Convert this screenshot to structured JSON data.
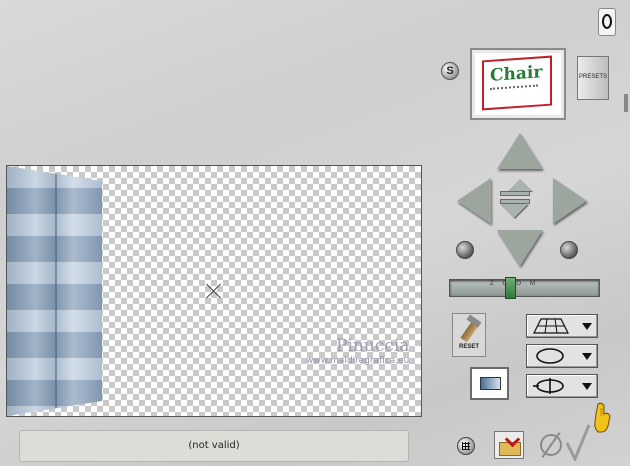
{
  "toolbar": {
    "help_label": "",
    "s_label": "S",
    "presets_label": "PRESETS",
    "reset_label": "RESET"
  },
  "preview": {
    "thumb_text": "Chair"
  },
  "zoom": {
    "label": "ZOOM",
    "level": 0.4
  },
  "watermark": {
    "name": "Pinuccia",
    "url": "www.maidiregrafica.eu"
  },
  "status": {
    "text": "(not valid)"
  },
  "colors": {
    "arrow": "#9ca59e",
    "zoom_thumb": "#2f7a3b",
    "panel": "#a9bdd1"
  },
  "icons": {
    "help": "help-icon",
    "s": "s-icon",
    "rotate_left": "rotate-left-icon",
    "rotate_right": "rotate-right-icon",
    "grid": "grid-icon",
    "import": "import-icon",
    "cancel": "cancel-icon",
    "ok": "checkmark-icon",
    "hand": "hand-pointer-icon"
  }
}
